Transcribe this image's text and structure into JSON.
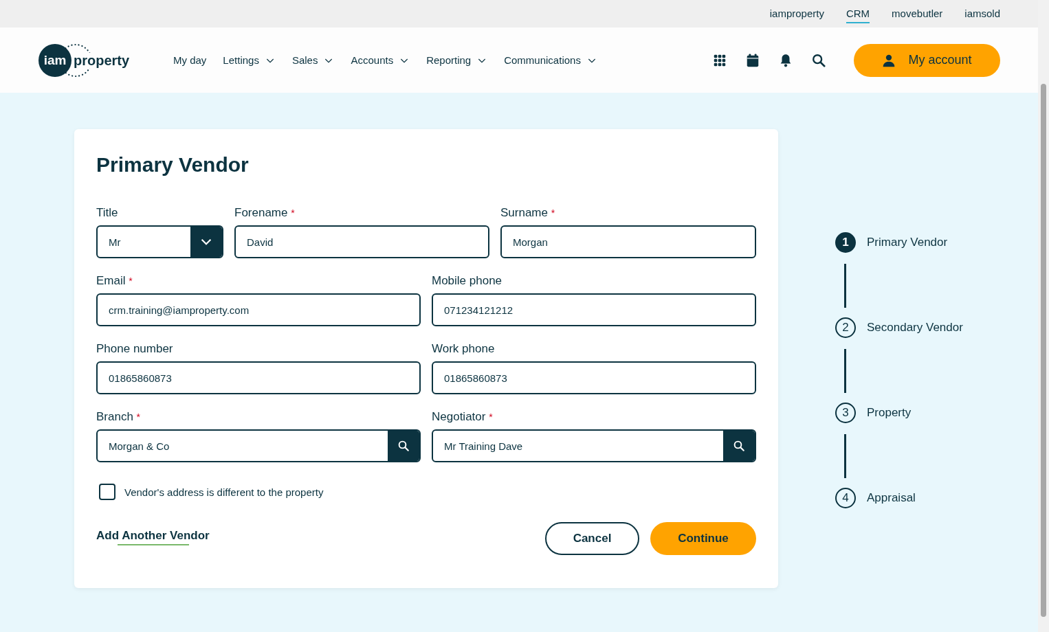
{
  "top_links": [
    {
      "label": "iamproperty",
      "selected": false
    },
    {
      "label": "CRM",
      "selected": true
    },
    {
      "label": "movebutler",
      "selected": false
    },
    {
      "label": "iamsold",
      "selected": false
    }
  ],
  "logo": {
    "badge": "iam",
    "text": "property"
  },
  "nav": [
    {
      "label": "My day",
      "dropdown": false
    },
    {
      "label": "Lettings",
      "dropdown": true
    },
    {
      "label": "Sales",
      "dropdown": true
    },
    {
      "label": "Accounts",
      "dropdown": true
    },
    {
      "label": "Reporting",
      "dropdown": true
    },
    {
      "label": "Communications",
      "dropdown": true
    }
  ],
  "account_button": "My account",
  "form": {
    "heading": "Primary Vendor",
    "required_mark": "*",
    "rows": [
      [
        {
          "label": "Title",
          "required": false,
          "value": "Mr",
          "kind": "select"
        },
        {
          "label": "Forename",
          "required": true,
          "value": "David",
          "kind": "text"
        },
        {
          "label": "Surname",
          "required": true,
          "value": "Morgan",
          "kind": "text"
        }
      ],
      [
        {
          "label": "Email",
          "required": true,
          "value": "crm.training@iamproperty.com",
          "kind": "text"
        },
        {
          "label": "Mobile phone",
          "required": false,
          "value": "071234121212",
          "kind": "text"
        }
      ],
      [
        {
          "label": "Phone number",
          "required": false,
          "value": "01865860873",
          "kind": "text"
        },
        {
          "label": "Work phone",
          "required": false,
          "value": "01865860873",
          "kind": "text"
        }
      ],
      [
        {
          "label": "Branch",
          "required": true,
          "value": "Morgan & Co",
          "kind": "lookup"
        },
        {
          "label": "Negotiator",
          "required": true,
          "value": "Mr Training Dave",
          "kind": "lookup"
        }
      ]
    ],
    "checkbox": {
      "label": "Vendor's address is different to the property",
      "checked": false
    },
    "add_link": "Add Another Vendor",
    "buttons": [
      {
        "label": "Cancel",
        "kind": "secondary"
      },
      {
        "label": "Continue",
        "kind": "primary"
      }
    ]
  },
  "steps": [
    {
      "number": "1",
      "label": "Primary Vendor",
      "selected": true
    },
    {
      "number": "2",
      "label": "Secondary Vendor",
      "selected": false
    },
    {
      "number": "3",
      "label": "Property",
      "selected": false
    },
    {
      "number": "4",
      "label": "Appraisal",
      "selected": false
    }
  ]
}
